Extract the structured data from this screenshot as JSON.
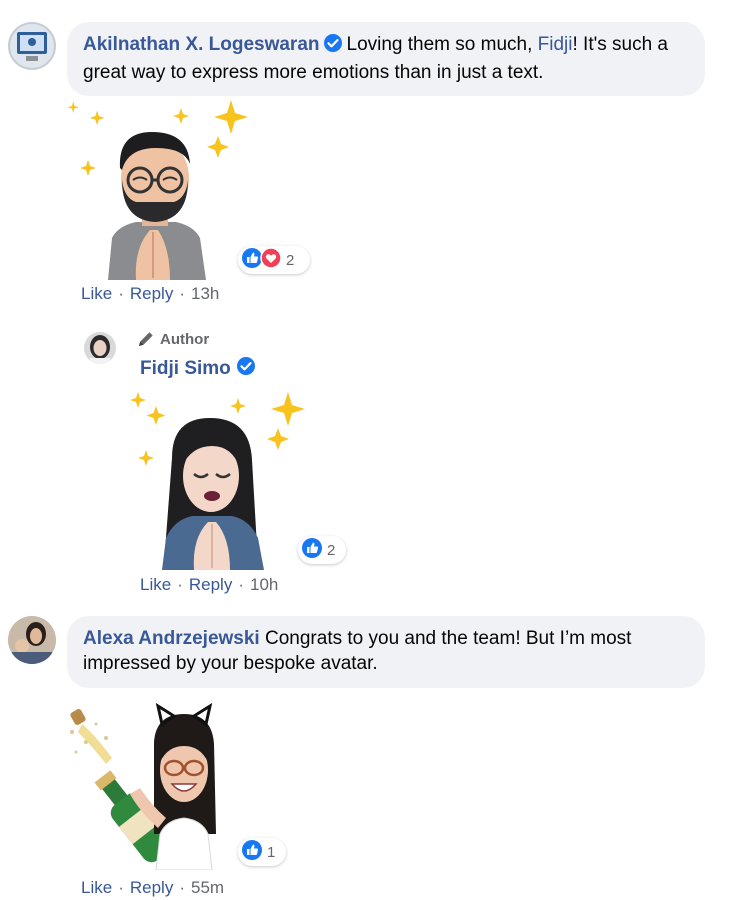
{
  "comments": [
    {
      "author": "Akilnathan X. Logeswaran",
      "text_before_mention": "Loving them so much, ",
      "mention": "Fidji",
      "text_after_mention": "! It's such a great way to express more emotions than in just a text.",
      "reaction_count": "2",
      "reactions": [
        "like",
        "love"
      ],
      "actions": {
        "like": "Like",
        "reply": "Reply",
        "time": "13h"
      }
    },
    {
      "author_tag": "Author",
      "author": "Fidji Simo",
      "reaction_count": "2",
      "reactions": [
        "like"
      ],
      "actions": {
        "like": "Like",
        "reply": "Reply",
        "time": "10h"
      }
    },
    {
      "author": "Alexa Andrzejewski",
      "text": "Congrats to you and the team! But I’m most impressed by your bespoke avatar.",
      "reaction_count": "1",
      "reactions": [
        "like"
      ],
      "actions": {
        "like": "Like",
        "reply": "Reply",
        "time": "55m"
      }
    }
  ],
  "separator": "·",
  "icons": {
    "verified": "verified-badge-icon",
    "like": "like-reaction-icon",
    "love": "love-reaction-icon",
    "pencil": "pencil-icon"
  },
  "colors": {
    "link": "#385898",
    "bubble": "#f0f2f5",
    "like_blue": "#1877f2",
    "love_red": "#f33e58",
    "sparkle": "#f7c31c"
  }
}
